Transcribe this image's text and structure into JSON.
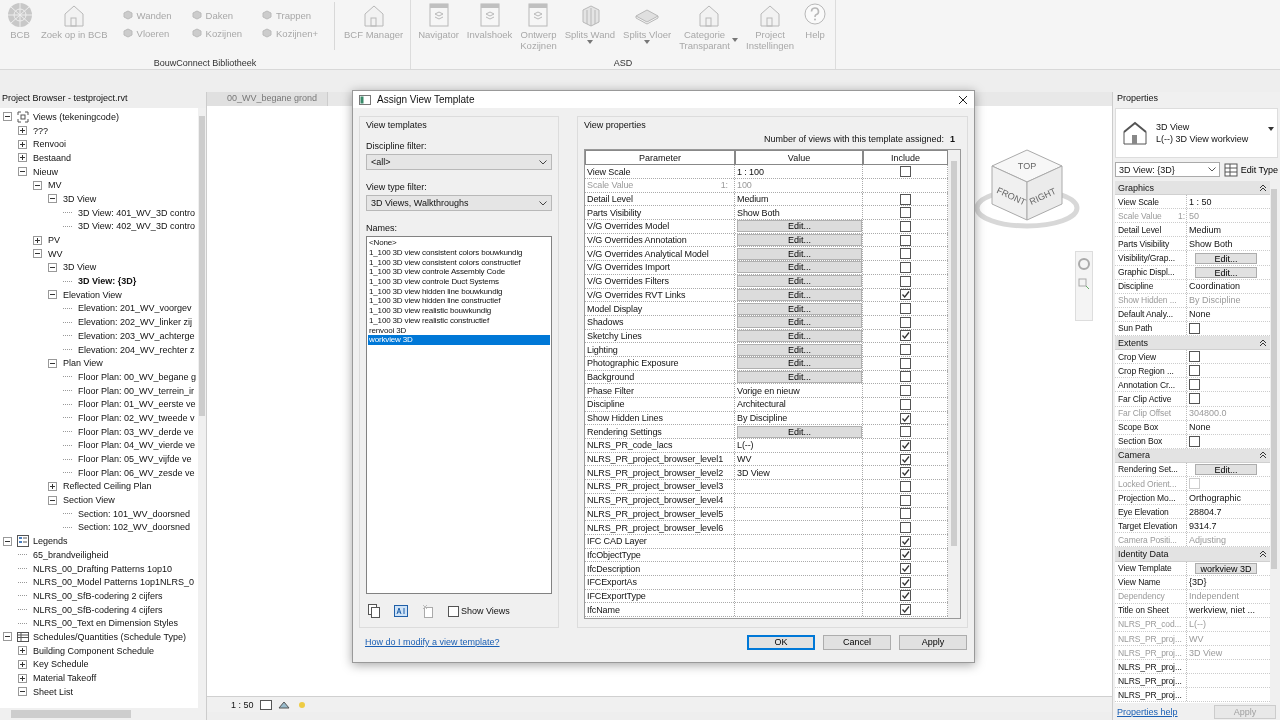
{
  "ribbon": {
    "panels": [
      {
        "label": "BouwConnect Bibliotheek",
        "items": [
          {
            "kind": "large",
            "label": "BCB",
            "dropdown": false
          },
          {
            "kind": "large",
            "label": "Zoek op in BCB",
            "dropdown": false
          },
          {
            "kind": "small_group",
            "items": [
              {
                "label": "Wanden"
              },
              {
                "label": "Vloeren"
              },
              {
                "label": "Daken"
              },
              {
                "label": "Kozijnen"
              },
              {
                "label": "Trappen"
              },
              {
                "label": "Kozijnen+"
              }
            ]
          },
          {
            "kind": "large",
            "label": "BCF Manager",
            "dropdown": false
          }
        ]
      },
      {
        "label": "ASD",
        "items": [
          {
            "kind": "large",
            "label": "Navigator",
            "dropdown": false
          },
          {
            "kind": "large",
            "label": "Invalshoek",
            "dropdown": false
          },
          {
            "kind": "large",
            "label": "Ontwerp\nKozijnen",
            "dropdown": false
          },
          {
            "kind": "large",
            "label": "Splits Wand",
            "dropdown": true
          },
          {
            "kind": "large",
            "label": "Splits Vloer",
            "dropdown": true
          },
          {
            "kind": "large",
            "label": "Categorie\nTransparant",
            "dropdown": true
          },
          {
            "kind": "large",
            "label": "Project\nInstellingen",
            "dropdown": false
          },
          {
            "kind": "large",
            "label": "Help",
            "dropdown": false
          }
        ]
      }
    ]
  },
  "browser": {
    "title": "Project Browser - testproject.rvt",
    "tree": [
      {
        "label": "Views (tekeningcode)",
        "expanded": true,
        "children": [
          {
            "label": "???",
            "expanded": false
          },
          {
            "label": "Renvooi",
            "expanded": false
          },
          {
            "label": "Bestaand",
            "expanded": false
          },
          {
            "label": "Nieuw",
            "expanded": true,
            "children": [
              {
                "label": "MV",
                "expanded": true,
                "children": [
                  {
                    "label": "3D View",
                    "expanded": true,
                    "children": [
                      {
                        "label": "3D View: 401_WV_3D contro"
                      },
                      {
                        "label": "3D View: 402_WV_3D contro"
                      }
                    ]
                  }
                ]
              },
              {
                "label": "PV",
                "expanded": false
              },
              {
                "label": "WV",
                "expanded": true,
                "children": [
                  {
                    "label": "3D View",
                    "expanded": true,
                    "children": [
                      {
                        "label": "3D View: {3D}",
                        "active": true
                      }
                    ]
                  },
                  {
                    "label": "Elevation View",
                    "expanded": true,
                    "children": [
                      {
                        "label": "Elevation: 201_WV_voorgev"
                      },
                      {
                        "label": "Elevation: 202_WV_linker zij"
                      },
                      {
                        "label": "Elevation: 203_WV_achterge"
                      },
                      {
                        "label": "Elevation: 204_WV_rechter z"
                      }
                    ]
                  },
                  {
                    "label": "Plan View",
                    "expanded": true,
                    "children": [
                      {
                        "label": "Floor Plan: 00_WV_begane g"
                      },
                      {
                        "label": "Floor Plan: 00_WV_terrein_ir"
                      },
                      {
                        "label": "Floor Plan: 01_WV_eerste ve"
                      },
                      {
                        "label": "Floor Plan: 02_WV_tweede v"
                      },
                      {
                        "label": "Floor Plan: 03_WV_derde ve"
                      },
                      {
                        "label": "Floor Plan: 04_WV_vierde ve"
                      },
                      {
                        "label": "Floor Plan: 05_WV_vijfde ve"
                      },
                      {
                        "label": "Floor Plan: 06_WV_zesde ve"
                      }
                    ]
                  },
                  {
                    "label": "Reflected Ceiling Plan",
                    "expanded": false
                  },
                  {
                    "label": "Section View",
                    "expanded": true,
                    "children": [
                      {
                        "label": "Section: 101_WV_doorsned"
                      },
                      {
                        "label": "Section: 102_WV_doorsned"
                      }
                    ]
                  }
                ]
              }
            ]
          }
        ]
      },
      {
        "label": "Legends",
        "expanded": true,
        "children": [
          {
            "label": "65_brandveiligheid"
          },
          {
            "label": "NLRS_00_Drafting Patterns 1op10"
          },
          {
            "label": "NLRS_00_Model Patterns 1op1NLRS_0"
          },
          {
            "label": "NLRS_00_SfB-codering 2 cijfers"
          },
          {
            "label": "NLRS_00_SfB-codering 4 cijfers"
          },
          {
            "label": "NLRS_00_Text en Dimension Styles"
          }
        ]
      },
      {
        "label": "Schedules/Quantities (Schedule Type)",
        "expanded": true,
        "children": [
          {
            "label": "Building Component Schedule",
            "expanded": false
          },
          {
            "label": "Key Schedule",
            "expanded": false
          },
          {
            "label": "Material Takeoff",
            "expanded": false
          },
          {
            "label": "Sheet List",
            "expanded": true
          }
        ]
      }
    ]
  },
  "view_tabs": [
    {
      "label": "00_WV_begane grond"
    }
  ],
  "viewcube": {
    "faces": [
      "TOP",
      "FRONT",
      "RIGHT"
    ]
  },
  "status_bar": {
    "scale": "1 : 50"
  },
  "properties": {
    "title": "Properties",
    "type_name": "3D View",
    "type_sub": "L(--) 3D View workview",
    "instance": "3D View: {3D}",
    "edit_type": "Edit Type",
    "sections": [
      {
        "title": "Graphics",
        "rows": [
          {
            "label": "View Scale",
            "kind": "text",
            "value": "1 : 50",
            "disabled": false
          },
          {
            "label": "Scale Value",
            "suffix": "1:",
            "kind": "text",
            "value": "50",
            "disabled": true
          },
          {
            "label": "Detail Level",
            "kind": "text",
            "value": "Medium",
            "disabled": false
          },
          {
            "label": "Parts Visibility",
            "kind": "text",
            "value": "Show Both",
            "disabled": false
          },
          {
            "label": "Visibility/Grap...",
            "kind": "button",
            "value": "Edit...",
            "disabled": false
          },
          {
            "label": "Graphic Displ...",
            "kind": "button",
            "value": "Edit...",
            "disabled": false
          },
          {
            "label": "Discipline",
            "kind": "text",
            "value": "Coordination",
            "disabled": false
          },
          {
            "label": "Show Hidden ...",
            "kind": "text",
            "value": "By Discipline",
            "disabled": true
          },
          {
            "label": "Default Analy...",
            "kind": "text",
            "value": "None",
            "disabled": false
          },
          {
            "label": "Sun Path",
            "kind": "check",
            "checked": false,
            "disabled": false
          }
        ]
      },
      {
        "title": "Extents",
        "rows": [
          {
            "label": "Crop View",
            "kind": "check",
            "checked": false,
            "disabled": false
          },
          {
            "label": "Crop Region ...",
            "kind": "check",
            "checked": false,
            "disabled": false
          },
          {
            "label": "Annotation Cr...",
            "kind": "check",
            "checked": false,
            "disabled": false
          },
          {
            "label": "Far Clip Active",
            "kind": "check",
            "checked": false,
            "disabled": false
          },
          {
            "label": "Far Clip Offset",
            "kind": "text",
            "value": "304800.0",
            "disabled": true
          },
          {
            "label": "Scope Box",
            "kind": "text",
            "value": "None",
            "disabled": false
          },
          {
            "label": "Section Box",
            "kind": "check",
            "checked": false,
            "disabled": false
          }
        ]
      },
      {
        "title": "Camera",
        "rows": [
          {
            "label": "Rendering Set...",
            "kind": "button",
            "value": "Edit...",
            "disabled": false
          },
          {
            "label": "Locked Orient...",
            "kind": "check",
            "checked": false,
            "disabled": true
          },
          {
            "label": "Projection Mo...",
            "kind": "text",
            "value": "Orthographic",
            "disabled": false
          },
          {
            "label": "Eye Elevation",
            "kind": "text",
            "value": "28804.7",
            "disabled": false
          },
          {
            "label": "Target Elevation",
            "kind": "text",
            "value": "9314.7",
            "disabled": false
          },
          {
            "label": "Camera Positi...",
            "kind": "text",
            "value": "Adjusting",
            "disabled": true
          }
        ]
      },
      {
        "title": "Identity Data",
        "rows": [
          {
            "label": "View Template",
            "kind": "button",
            "value": "workview 3D",
            "disabled": false
          },
          {
            "label": "View Name",
            "kind": "text",
            "value": "{3D}",
            "disabled": false
          },
          {
            "label": "Dependency",
            "kind": "text",
            "value": "Independent",
            "disabled": true
          },
          {
            "label": "Title on Sheet",
            "kind": "text",
            "value": "werkview, niet ...",
            "disabled": false
          },
          {
            "label": "NLRS_PR_cod...",
            "kind": "text",
            "value": "L(--)",
            "disabled": true
          },
          {
            "label": "NLRS_PR_proj...",
            "kind": "text",
            "value": "WV",
            "disabled": true
          },
          {
            "label": "NLRS_PR_proj...",
            "kind": "text",
            "value": "3D View",
            "disabled": true
          },
          {
            "label": "NLRS_PR_proj...",
            "kind": "text",
            "disabled": false
          },
          {
            "label": "NLRS_PR_proj...",
            "kind": "text",
            "disabled": false
          },
          {
            "label": "NLRS_PR_proj...",
            "kind": "text",
            "disabled": false
          }
        ]
      }
    ],
    "help": "Properties help",
    "apply": {
      "label": "Apply",
      "disabled": true
    }
  },
  "dialog": {
    "title": "Assign View Template",
    "templates": {
      "group": "View templates",
      "discipline_label": "Discipline filter:",
      "discipline": "<all>",
      "type_label": "View type filter:",
      "view_type": "3D Views, Walkthroughs",
      "names_label": "Names:",
      "names": [
        {
          "label": "<None>",
          "selected": false
        },
        {
          "label": "1_100 3D view consistent colors bouwkundig",
          "selected": false
        },
        {
          "label": "1_100 3D view consistent colors constructief",
          "selected": false
        },
        {
          "label": "1_100 3D view controle Assembly Code",
          "selected": false
        },
        {
          "label": "1_100 3D view controle Duct Systems",
          "selected": false
        },
        {
          "label": "1_100 3D view hidden line bouwkundig",
          "selected": false
        },
        {
          "label": "1_100 3D view hidden line constructief",
          "selected": false
        },
        {
          "label": "1_100 3D view realistic bouwkundig",
          "selected": false
        },
        {
          "label": "1_100 3D view realistic constructief",
          "selected": false
        },
        {
          "label": "renvooi 3D",
          "selected": false
        },
        {
          "label": "workview 3D",
          "selected": true
        }
      ],
      "show_views": {
        "label": "Show Views",
        "checked": false
      },
      "help_link": "How do I modify a view template?"
    },
    "view_properties": {
      "group": "View properties",
      "count_label": "Number of views with this template assigned:",
      "count": "1",
      "columns": [
        "Parameter",
        "Value",
        "Include"
      ],
      "rows": [
        {
          "parameter": "View Scale",
          "kind": "text",
          "value": "1 : 100",
          "include": false,
          "disabled": false
        },
        {
          "parameter": "Scale Value",
          "suffix": "1:",
          "kind": "text",
          "value": "100",
          "disabled": true
        },
        {
          "parameter": "Detail Level",
          "kind": "text",
          "value": "Medium",
          "include": false,
          "disabled": false
        },
        {
          "parameter": "Parts Visibility",
          "kind": "text",
          "value": "Show Both",
          "include": false,
          "disabled": false
        },
        {
          "parameter": "V/G Overrides Model",
          "kind": "button",
          "value": "Edit...",
          "include": false,
          "disabled": false
        },
        {
          "parameter": "V/G Overrides Annotation",
          "kind": "button",
          "value": "Edit...",
          "include": false,
          "disabled": false
        },
        {
          "parameter": "V/G Overrides Analytical Model",
          "kind": "button",
          "value": "Edit...",
          "include": false,
          "disabled": false
        },
        {
          "parameter": "V/G Overrides Import",
          "kind": "button",
          "value": "Edit...",
          "include": false,
          "disabled": false
        },
        {
          "parameter": "V/G Overrides Filters",
          "kind": "button",
          "value": "Edit...",
          "include": false,
          "disabled": false
        },
        {
          "parameter": "V/G Overrides RVT Links",
          "kind": "button",
          "value": "Edit...",
          "include": true,
          "disabled": false
        },
        {
          "parameter": "Model Display",
          "kind": "button",
          "value": "Edit...",
          "include": false,
          "disabled": false
        },
        {
          "parameter": "Shadows",
          "kind": "button",
          "value": "Edit...",
          "include": false,
          "disabled": false
        },
        {
          "parameter": "Sketchy Lines",
          "kind": "button",
          "value": "Edit...",
          "include": true,
          "disabled": false
        },
        {
          "parameter": "Lighting",
          "kind": "button",
          "value": "Edit...",
          "include": false,
          "disabled": false
        },
        {
          "parameter": "Photographic Exposure",
          "kind": "button",
          "value": "Edit...",
          "include": false,
          "disabled": false
        },
        {
          "parameter": "Background",
          "kind": "button",
          "value": "Edit...",
          "include": false,
          "disabled": false
        },
        {
          "parameter": "Phase Filter",
          "kind": "text",
          "value": "Vorige en nieuw",
          "include": false,
          "disabled": false
        },
        {
          "parameter": "Discipline",
          "kind": "text",
          "value": "Architectural",
          "include": false,
          "disabled": false
        },
        {
          "parameter": "Show Hidden Lines",
          "kind": "text",
          "value": "By Discipline",
          "include": true,
          "disabled": false
        },
        {
          "parameter": "Rendering Settings",
          "kind": "button",
          "value": "Edit...",
          "include": false,
          "disabled": false
        },
        {
          "parameter": "NLRS_PR_code_lacs",
          "kind": "text",
          "value": "L(--)",
          "include": true,
          "disabled": false
        },
        {
          "parameter": "NLRS_PR_project_browser_level1",
          "kind": "text",
          "value": "WV",
          "include": true,
          "disabled": false
        },
        {
          "parameter": "NLRS_PR_project_browser_level2",
          "kind": "text",
          "value": "3D View",
          "include": true,
          "disabled": false
        },
        {
          "parameter": "NLRS_PR_project_browser_level3",
          "kind": "text",
          "include": false,
          "disabled": false
        },
        {
          "parameter": "NLRS_PR_project_browser_level4",
          "kind": "text",
          "include": false,
          "disabled": false
        },
        {
          "parameter": "NLRS_PR_project_browser_level5",
          "kind": "text",
          "include": false,
          "disabled": false
        },
        {
          "parameter": "NLRS_PR_project_browser_level6",
          "kind": "text",
          "include": false,
          "disabled": false
        },
        {
          "parameter": "IFC CAD Layer",
          "kind": "text",
          "include": true,
          "disabled": false
        },
        {
          "parameter": "IfcObjectType",
          "kind": "text",
          "include": true,
          "disabled": false
        },
        {
          "parameter": "IfcDescription",
          "kind": "text",
          "include": true,
          "disabled": false
        },
        {
          "parameter": "IFCExportAs",
          "kind": "text",
          "include": true,
          "disabled": false
        },
        {
          "parameter": "IFCExportType",
          "kind": "text",
          "include": true,
          "disabled": false
        },
        {
          "parameter": "IfcName",
          "kind": "text",
          "include": true,
          "disabled": false
        }
      ]
    },
    "buttons": [
      {
        "label": "OK",
        "default": true
      },
      {
        "label": "Cancel",
        "default": false
      },
      {
        "label": "Apply",
        "default": false
      }
    ]
  }
}
